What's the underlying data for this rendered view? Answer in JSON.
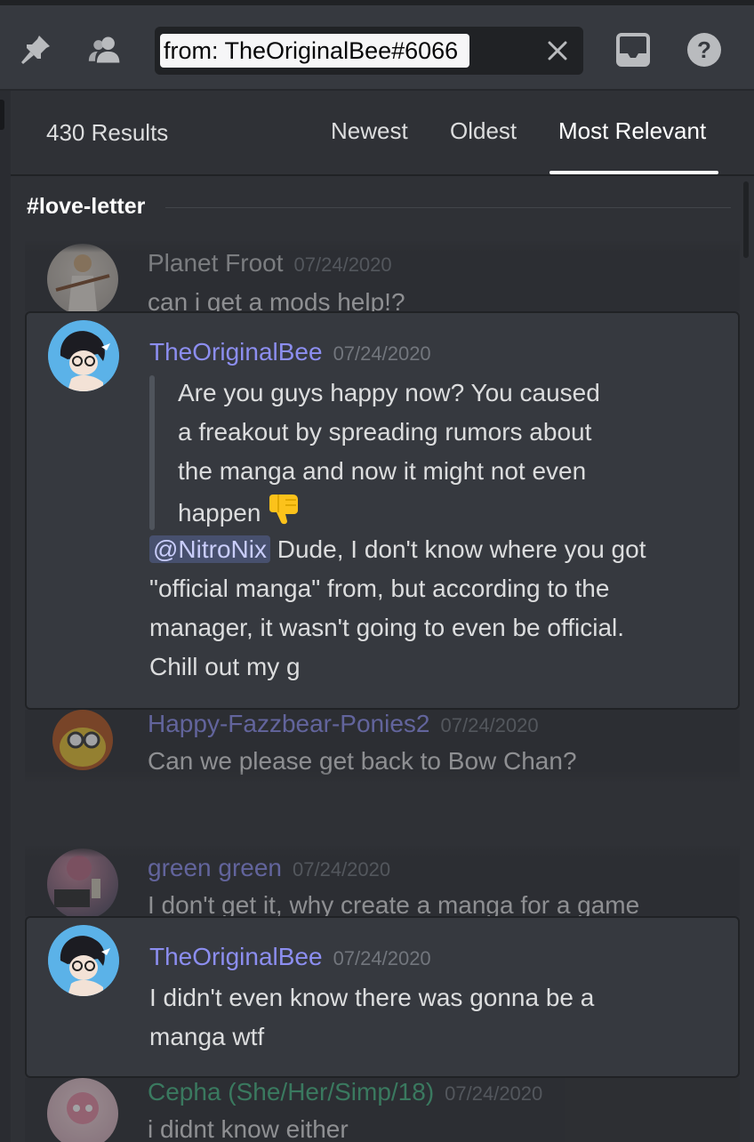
{
  "toolbar": {
    "search_query": "from: TheOriginalBee#6066",
    "icons": [
      "pin-icon",
      "members-icon",
      "close-icon",
      "inbox-icon",
      "help-icon"
    ]
  },
  "results": {
    "count_label": "430 Results",
    "sort_tabs": [
      {
        "label": "Newest",
        "active": false
      },
      {
        "label": "Oldest",
        "active": false
      },
      {
        "label": "Most Relevant",
        "active": true
      }
    ]
  },
  "channel": {
    "name": "#love-letter"
  },
  "messages": {
    "ctx1": {
      "author": "Planet Froot",
      "time": "07/24/2020",
      "text": "can i get a mods help!?"
    },
    "hit1": {
      "author": "TheOriginalBee",
      "time": "07/24/2020",
      "quote_lines": [
        "Are you guys happy now? You caused",
        "a freakout by spreading rumors about",
        "the manga and now it might not even",
        "happen"
      ],
      "mention": "@NitroNix",
      "body_first": " Dude, I don't know where you got",
      "body_lines": [
        "\"official manga\" from, but according to the",
        "manager, it wasn't going to even be official.",
        "Chill out my g"
      ]
    },
    "ctx2": {
      "author": "Happy-Fazzbear-Ponies2",
      "time": "07/24/2020",
      "text": "Can we please get back to Bow Chan?"
    },
    "ctx3": {
      "author": "green green",
      "time": "07/24/2020",
      "text": "I don't get it, why create a manga for a game"
    },
    "hit2": {
      "author": "TheOriginalBee",
      "time": "07/24/2020",
      "body_lines": [
        "I didn't even know there was gonna be a",
        "manga wtf"
      ]
    },
    "ctx4": {
      "author": "Cepha (She/Her/Simp/18)",
      "time": "07/24/2020",
      "text": "i didnt know either"
    }
  },
  "colors": {
    "author_highlight": "#8c8ef0",
    "author_green": "#43b581",
    "background": "#2f3136"
  }
}
